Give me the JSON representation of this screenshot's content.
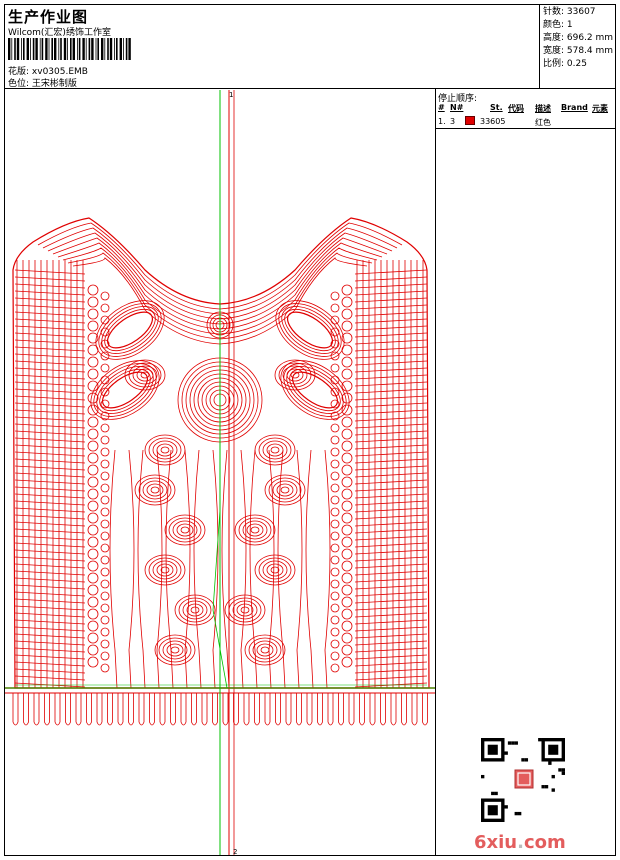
{
  "header": {
    "title": "生产作业图",
    "company": "Wilcom(汇宏)绣饰工作室",
    "design_label": "花版:",
    "design_value": "xv0305.EMB",
    "colorway_label": "色位:",
    "colorway_value": "王宋彬制版"
  },
  "stats": {
    "stitches": "针数: 33607",
    "colors": "颜色: 1",
    "height": "高度: 696.2 mm",
    "width": "宽度: 578.4 mm",
    "scale": "比例: 0.25"
  },
  "stop_sequence": {
    "title": "停止顺序:",
    "headers": {
      "num": "#",
      "no": "N#",
      "st": "St.",
      "code": "代码",
      "desc": "描述",
      "brand": "Brand",
      "element": "元素"
    },
    "rows": [
      {
        "num": "1.",
        "no": "3",
        "st": "33605",
        "desc": "红色",
        "color": "#e00000"
      }
    ]
  },
  "canvas": {
    "top_marker": "1",
    "bottom_marker": "2",
    "stitch_color": "#e00000",
    "guide_color": "#00c000"
  },
  "watermark": {
    "text_main": "6xiu",
    "text_dot": ".",
    "text_tail": "com"
  }
}
